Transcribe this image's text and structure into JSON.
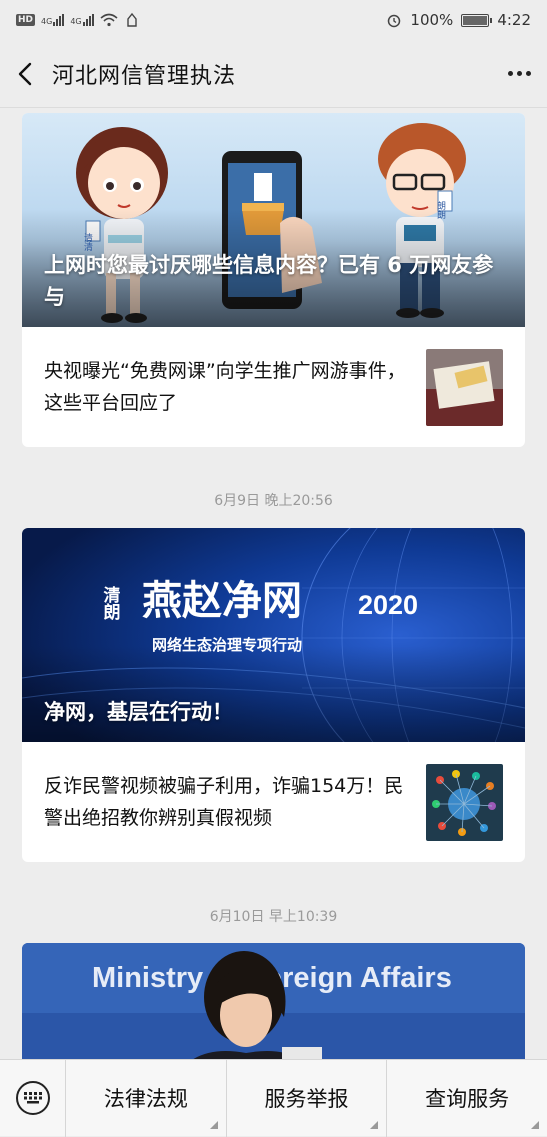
{
  "status": {
    "hd": "HD",
    "sim1": "4G",
    "sim2": "4G",
    "battery": "100%",
    "time": "4:22"
  },
  "nav": {
    "title": "河北网信管理执法",
    "back_icon": "chevron-left-icon",
    "more_icon": "more-dots-icon"
  },
  "feed": {
    "group1": {
      "hero_title": "上网时您最讨厌哪些信息内容？已有 6 万网友参与",
      "hero_labels": {
        "left_badge": "清清",
        "right_badge": "朗朗"
      },
      "item_title": "央视曝光“免费网课”向学生推广网游事件，这些平台回应了"
    },
    "timestamp1": "6月9日 晚上20:56",
    "group2": {
      "hero_title": "净网，基层在行动！",
      "banner_small": "清朗",
      "banner_main": "燕赵净网",
      "banner_year": "2020",
      "banner_sub": "网络生态治理专项行动",
      "item_title": "反诈民警视频被骗子利用，诈骗154万！民警出绝招教你辨别真假视频"
    },
    "timestamp2": "6月10日 早上10:39",
    "group3": {
      "hero_backdrop_text": "Ministry of Foreign Affairs"
    }
  },
  "menu": {
    "keyboard_icon": "keyboard-icon",
    "items": [
      "法律法规",
      "服务举报",
      "查询服务"
    ]
  },
  "colors": {
    "background": "#ededed",
    "card": "#ffffff",
    "timestamp": "#9a9a9a",
    "hero2_blue": "#0b2a6b"
  }
}
